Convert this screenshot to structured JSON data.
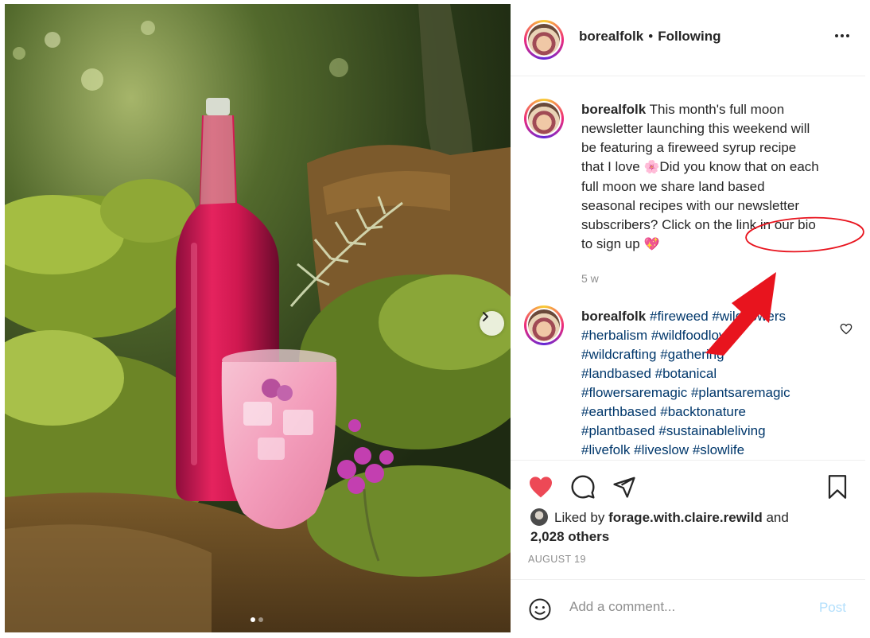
{
  "post": {
    "username": "borealfolk",
    "separator": "•",
    "follow_status": "Following"
  },
  "caption": {
    "username": "borealfolk",
    "line1": "This month's full moon",
    "line2": "newsletter launching this weekend will",
    "line3": "be featuring a fireweed syrup recipe",
    "line4a": "that I love",
    "line4b": "Did you know that on each",
    "line5": "full moon we share land based",
    "line6": "seasonal recipes with our newsletter",
    "line7": "subscribers? Click on the link in our bio",
    "line8": "to sign up",
    "emoji_flower": "🌸",
    "emoji_heart": "💖",
    "age": "5 w"
  },
  "hashtag_comment": {
    "username": "borealfolk",
    "tags": [
      "#fireweed #wildflowers",
      "#herbalism #wildfoodlove",
      "#wildcrafting #gathering",
      "#landbased #botanical",
      "#flowersaremagic #plantsaremagic",
      "#earthbased #backtonature",
      "#plantbased #sustainableliving",
      "#livefolk #liveslow #slowlife"
    ]
  },
  "likes": {
    "prefix": "Liked by",
    "user": "forage.with.claire.rewild",
    "and": "and",
    "others": "2,028 others"
  },
  "date": "AUGUST 19",
  "comment_box": {
    "placeholder": "Add a comment...",
    "post_label": "Post"
  },
  "carousel": {
    "total": 2,
    "active": 1
  },
  "icons": {
    "like": "heart-filled-icon",
    "comment": "comment-icon",
    "share": "paper-plane-icon",
    "save": "bookmark-icon",
    "more": "more-options-icon",
    "next": "chevron-right-icon",
    "emoji": "smiley-icon",
    "comment_like": "heart-outline-icon"
  },
  "colors": {
    "like_red": "#ed4956",
    "hashtag_blue": "#00376b",
    "muted_gray": "#8e8e8e",
    "post_disabled": "#b2dffc",
    "annotation_red": "#e8141e"
  }
}
